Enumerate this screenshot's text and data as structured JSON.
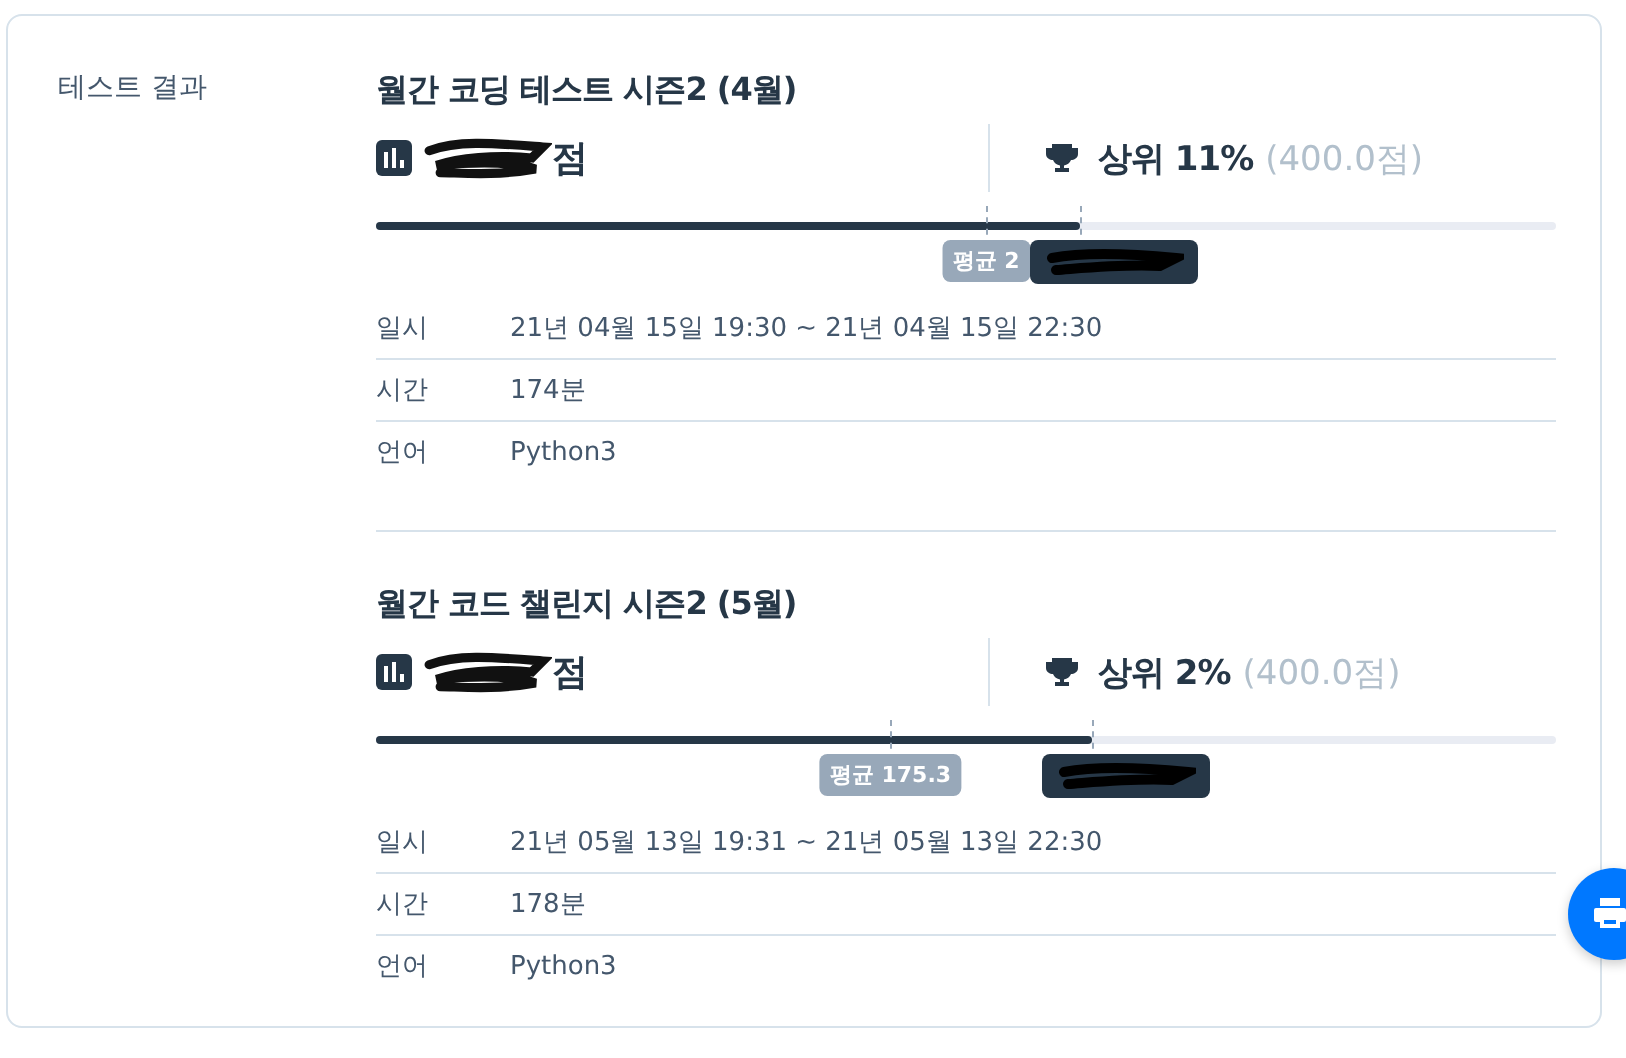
{
  "section_label": "테스트 결과",
  "tests": [
    {
      "title": "월간 코딩 테스트 시즌2 (4월)",
      "score": {
        "redacted": true,
        "unit": "점"
      },
      "rank": {
        "label": "상위 11%",
        "points": "(400.0점)"
      },
      "bar": {
        "level": 0.597,
        "average": {
          "level": 0.517,
          "label": "평균 2"
        },
        "mine": {
          "redacted": true
        }
      },
      "info": [
        {
          "label": "일시",
          "value": "21년 04월 15일 19:30 ~ 21년 04월 15일 22:30"
        },
        {
          "label": "시간",
          "value": "174분"
        },
        {
          "label": "언어",
          "value": "Python3"
        }
      ]
    },
    {
      "title": "월간 코드 챌린지 시즌2 (5월)",
      "score": {
        "redacted": true,
        "unit": "점"
      },
      "rank": {
        "label": "상위 2%",
        "points": "(400.0점)"
      },
      "bar": {
        "level": 0.607,
        "average": {
          "level": 0.436,
          "label": "평균 175.3"
        },
        "mine": {
          "redacted": true
        }
      },
      "info": [
        {
          "label": "일시",
          "value": "21년 05월 13일 19:31 ~ 21년 05월 13일 22:30"
        },
        {
          "label": "시간",
          "value": "178분"
        },
        {
          "label": "언어",
          "value": "Python3"
        }
      ]
    }
  ]
}
